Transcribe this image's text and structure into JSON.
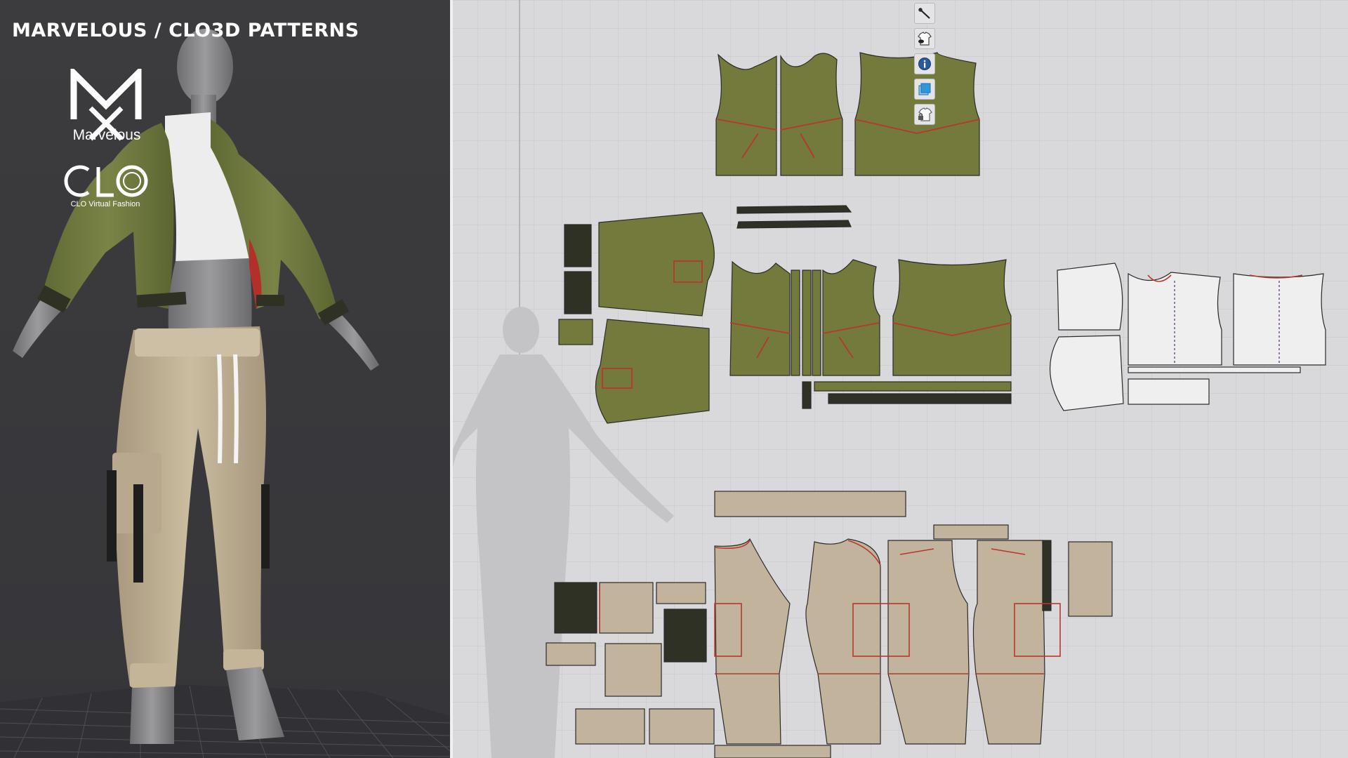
{
  "banner": {
    "title": "MARVELOUS / CLO3D PATTERNS",
    "marvelous_logo_text": "Marvelous",
    "clo_logo_text": "CLO Virtual Fashion"
  },
  "toolbar": {
    "tools": [
      {
        "icon": "needle-icon"
      },
      {
        "icon": "garment-visibility-icon"
      },
      {
        "icon": "info-icon"
      },
      {
        "icon": "fabric-layer-icon"
      },
      {
        "icon": "garment-lock-icon"
      }
    ]
  },
  "colors": {
    "background_3d": "#3a3a3c",
    "pattern_board": "#d8d8da",
    "jacket_olive": "#737a3c",
    "trouser_beige": "#c2b49c",
    "lining_white": "#efefef",
    "rib_dark": "#2e3123",
    "seam_red": "#c0392b",
    "avatar_grey": "#888888"
  }
}
